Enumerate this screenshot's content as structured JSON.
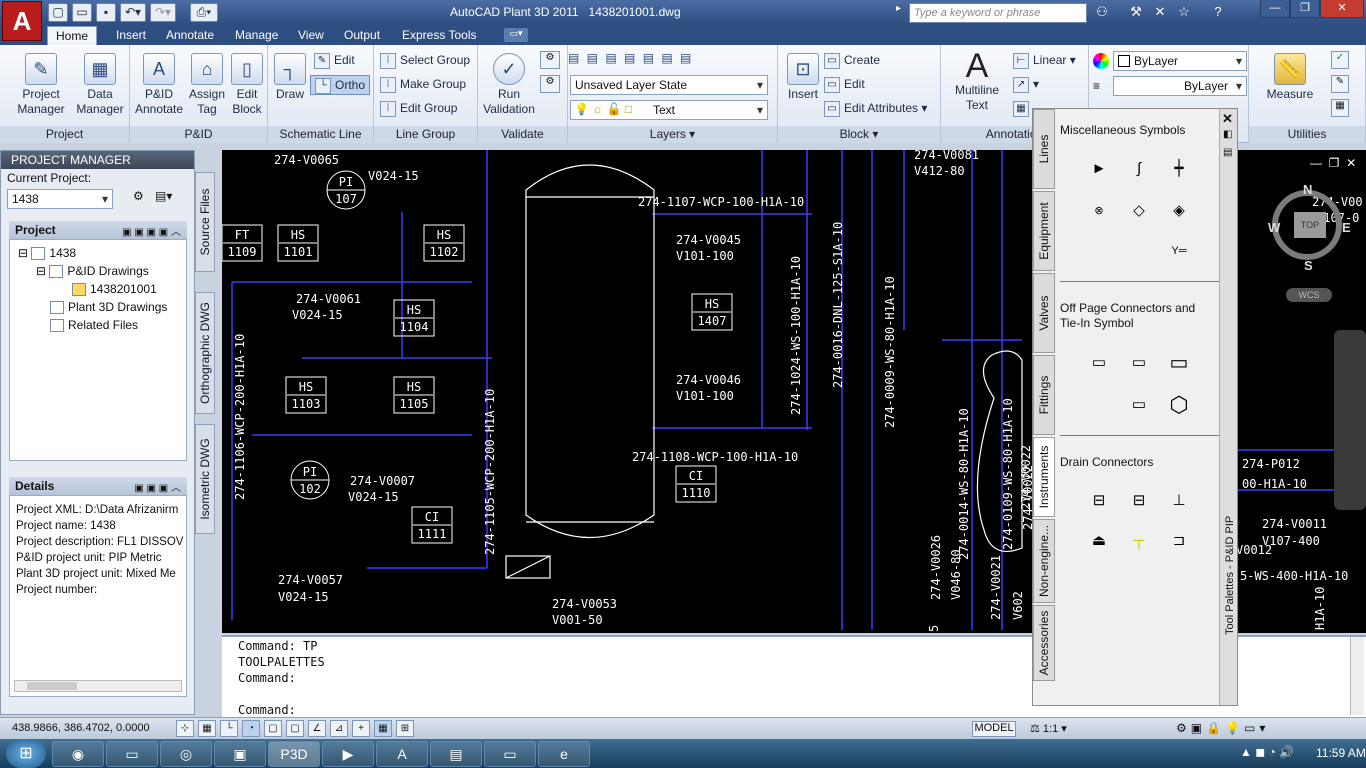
{
  "app": {
    "title": "AutoCAD Plant 3D 2011",
    "filename": "1438201001.dwg",
    "search_placeholder": "Type a keyword or phrase",
    "logo": "A"
  },
  "tabs": [
    "Home",
    "Insert",
    "Annotate",
    "Manage",
    "View",
    "Output",
    "Express Tools"
  ],
  "ribbon": {
    "project": {
      "title": "Project",
      "manager": "Project\nManager",
      "data_manager": "Data\nManager"
    },
    "pid": {
      "title": "P&ID",
      "annotate": "P&ID\nAnnotate",
      "assign_tag": "Assign\nTag",
      "edit_block": "Edit\nBlock"
    },
    "schematic": {
      "title": "Schematic Line",
      "draw": "Draw",
      "edit": "Edit",
      "ortho": "Ortho"
    },
    "linegroup": {
      "title": "Line Group",
      "select": "Select Group",
      "make": "Make Group",
      "edit": "Edit Group"
    },
    "validate": {
      "title": "Validate",
      "run": "Run\nValidation"
    },
    "layers": {
      "title": "Layers",
      "state": "Unsaved Layer State",
      "layer": "Text"
    },
    "block": {
      "title": "Block",
      "insert": "Insert",
      "create": "Create",
      "edit": "Edit",
      "edit_attr": "Edit Attributes"
    },
    "annotation": {
      "title": "Annotation",
      "mtext": "Multiline\nText",
      "linear": "Linear"
    },
    "properties": {
      "color": "ByLayer",
      "linetype": "ByLayer"
    },
    "utilities": {
      "title": "Utilities",
      "measure": "Measure"
    }
  },
  "pm": {
    "title": "PROJECT MANAGER",
    "current_label": "Current Project:",
    "current": "1438",
    "project_section": "Project",
    "tree": [
      "1438",
      "P&ID Drawings",
      "1438201001",
      "Plant 3D Drawings",
      "Related Files"
    ],
    "details_section": "Details",
    "details": [
      "Project XML: D:\\Data Afrizanirm",
      "Project name: 1438",
      "Project description: FL1 DISSOV",
      "P&ID project unit: PIP Metric",
      "Plant 3D project unit: Mixed Me",
      "Project number:"
    ],
    "side_tabs": [
      "Source Files",
      "Orthographic DWG",
      "Isometric DWG"
    ]
  },
  "drawing": {
    "labels": [
      "274-V0065",
      "V024-15",
      "274-V0061",
      "V024-15",
      "274-V0007",
      "V024-15",
      "274-V0057",
      "V024-15",
      "274-1107-WCP-100-H1A-10",
      "274-V0045",
      "V101-100",
      "274-V0046",
      "V101-100",
      "274-1108-WCP-100-H1A-10",
      "274-V0053",
      "V001-50",
      "274-V0081",
      "V412-80",
      "274-P012",
      "00-H1A-10",
      "274-V0011",
      "V107-400",
      "V0012",
      "5-WS-400-H1A-10",
      "274-V00",
      "V107-0"
    ],
    "vlabels": [
      "274-1106-WCP-200-H1A-10",
      "274-1105-WCP-200-H1A-10",
      "274-1024-WS-100-H1A-10",
      "274-0016-DNL-125-S1A-10",
      "274-0009-WS-80-H1A-10",
      "274-0014-WS-80-H1A-10",
      "274-0109-WS-80-H1A-10",
      "274-V0026",
      "V046-80",
      "274-V0021",
      "V602",
      "274-V0022",
      "274-1-10",
      "274-1-10",
      "H1A-10",
      "274-V0022",
      "5"
    ],
    "instruments": [
      {
        "t": "PI",
        "n": "107"
      },
      {
        "t": "FT",
        "n": "1109"
      },
      {
        "t": "HS",
        "n": "1101"
      },
      {
        "t": "HS",
        "n": "1102"
      },
      {
        "t": "HS",
        "n": "1104"
      },
      {
        "t": "HS",
        "n": "1103"
      },
      {
        "t": "HS",
        "n": "1105"
      },
      {
        "t": "PI",
        "n": "102"
      },
      {
        "t": "CI",
        "n": "1111"
      },
      {
        "t": "HS",
        "n": "1407"
      },
      {
        "t": "CI",
        "n": "1110"
      }
    ],
    "compass": [
      "N",
      "S",
      "W",
      "E",
      "TOP",
      "WCS"
    ]
  },
  "command": [
    "Command: TP",
    "TOOLPALETTES",
    "Command:",
    "",
    "Command:"
  ],
  "palette": {
    "title": "Tool Palettes - P&ID PIP",
    "tabs": [
      "Lines",
      "Equipment",
      "Valves",
      "Fittings",
      "Instruments",
      "Non-engine...",
      "Accessories"
    ],
    "sections": [
      "Miscellaneous Symbols",
      "Off Page Connectors and Tie-In Symbol",
      "Drain Connectors"
    ]
  },
  "status": {
    "coords": "438.9866, 386.4702, 0.0000",
    "model": "MODEL",
    "scale": "1:1"
  },
  "taskbar": {
    "time": "11:59 AM"
  }
}
